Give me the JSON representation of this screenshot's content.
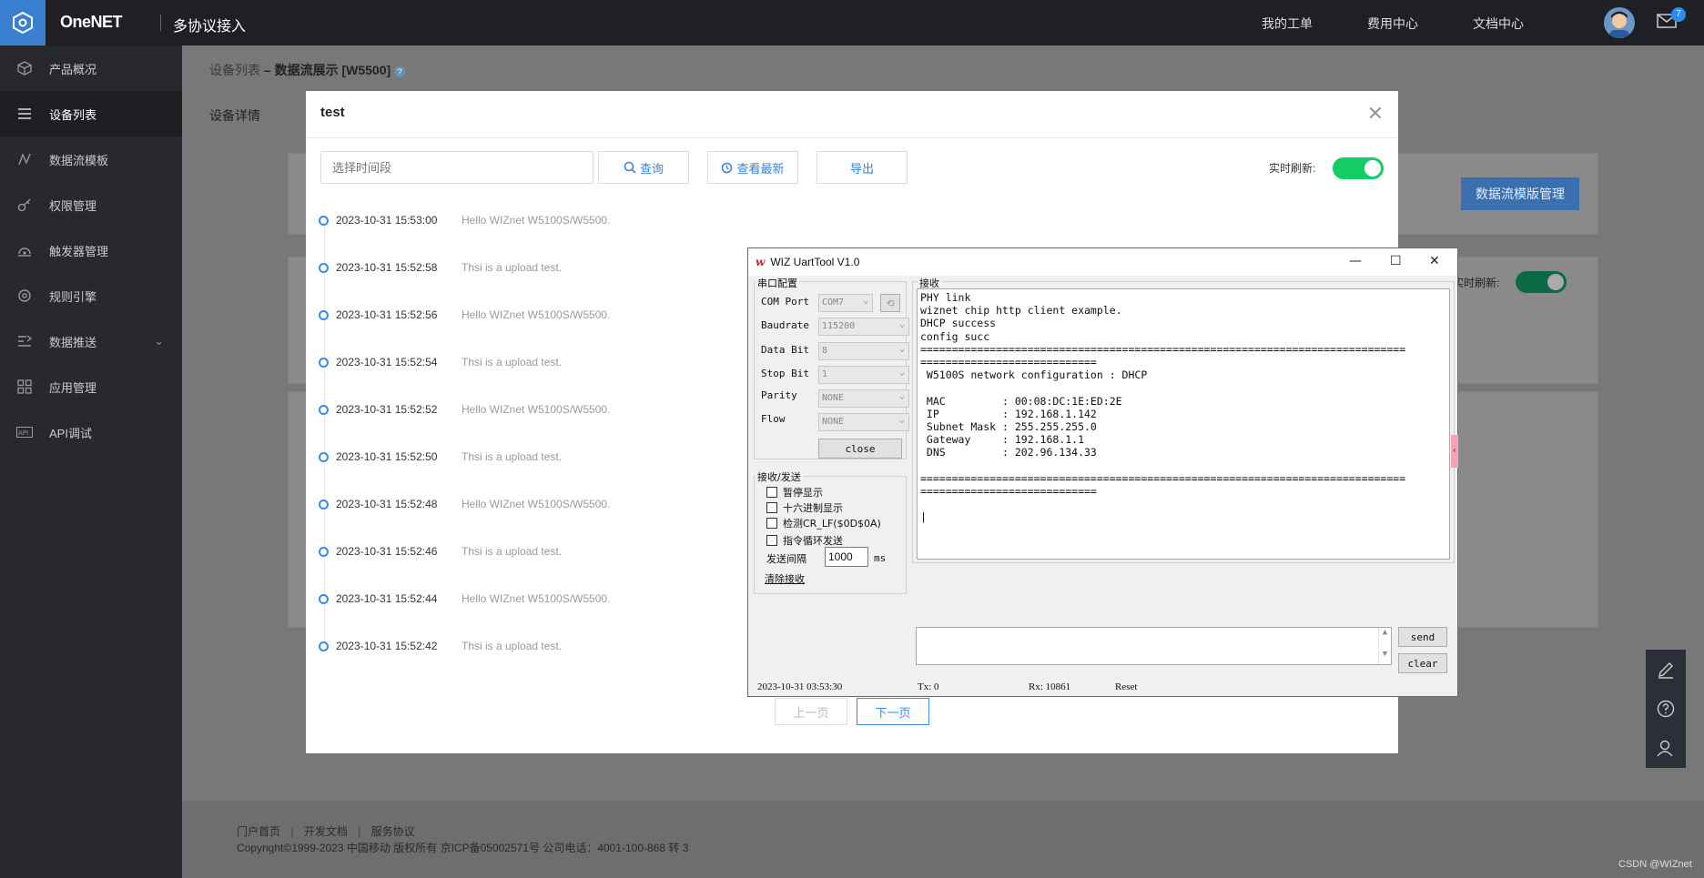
{
  "topbar": {
    "brand": "OneNET",
    "subtitle": "多协议接入",
    "nav": [
      "我的工单",
      "费用中心",
      "文档中心"
    ],
    "mail_badge": "7"
  },
  "sidebar": {
    "items": [
      {
        "label": "产品概况",
        "icon": "cube-icon"
      },
      {
        "label": "设备列表",
        "icon": "list-icon"
      },
      {
        "label": "数据流模板",
        "icon": "stream-icon"
      },
      {
        "label": "权限管理",
        "icon": "key-icon"
      },
      {
        "label": "触发器管理",
        "icon": "trigger-icon"
      },
      {
        "label": "规则引擎",
        "icon": "engine-icon"
      },
      {
        "label": "数据推送",
        "icon": "push-icon"
      },
      {
        "label": "应用管理",
        "icon": "grid-icon"
      },
      {
        "label": "API调试",
        "icon": "api-icon"
      }
    ]
  },
  "breadcrumb": {
    "parent": "设备列表",
    "current": "– 数据流展示 [W5500]"
  },
  "detail_tab": "设备详情",
  "bg": {
    "template_button": "数据流模版管理",
    "realtime_label": "实时刷新:"
  },
  "footer": {
    "links": [
      "门户首页",
      "开发文档",
      "服务协议"
    ],
    "copyright": "Copyright©1999-2023 中国移动 版权所有 京ICP备05002571号 公司电话：4001-100-868 转 3"
  },
  "watermark": "CSDN @WIZnet",
  "modal": {
    "title": "test",
    "range_placeholder": "选择时间段",
    "query_button": "查询",
    "latest_button": "查看最新",
    "export_button": "导出",
    "realtime_label": "实时刷新:",
    "timeline": [
      {
        "time": "2023-10-31 15:53:00",
        "msg": "Hello WIZnet W5100S/W5500."
      },
      {
        "time": "2023-10-31 15:52:58",
        "msg": "Thsi is a upload test."
      },
      {
        "time": "2023-10-31 15:52:56",
        "msg": "Hello WIZnet W5100S/W5500."
      },
      {
        "time": "2023-10-31 15:52:54",
        "msg": "Thsi is a upload test."
      },
      {
        "time": "2023-10-31 15:52:52",
        "msg": "Hello WIZnet W5100S/W5500."
      },
      {
        "time": "2023-10-31 15:52:50",
        "msg": "Thsi is a upload test."
      },
      {
        "time": "2023-10-31 15:52:48",
        "msg": "Hello WIZnet W5100S/W5500."
      },
      {
        "time": "2023-10-31 15:52:46",
        "msg": "Thsi is a upload test."
      },
      {
        "time": "2023-10-31 15:52:44",
        "msg": "Hello WIZnet W5100S/W5500."
      },
      {
        "time": "2023-10-31 15:52:42",
        "msg": "Thsi is a upload test."
      }
    ],
    "prev_page": "上一页",
    "next_page": "下一页"
  },
  "uart": {
    "title": "WIZ UartTool V1.0",
    "serial_group": "串口配置",
    "com_port_label": "COM Port",
    "com_port_value": "COM7",
    "baudrate_label": "Baudrate",
    "baudrate_value": "115200",
    "databit_label": "Data Bit",
    "databit_value": "8",
    "stopbit_label": "Stop Bit",
    "stopbit_value": "1",
    "parity_label": "Parity",
    "parity_value": "NONE",
    "flow_label": "Flow",
    "flow_value": "NONE",
    "close_button": "close",
    "rxtx_group": "接收/发送",
    "pause_display": "暂停显示",
    "hex_display": "十六进制显示",
    "detect_crlf": "检测CR_LF($0D$0A)",
    "loop_send": "指令循环发送",
    "interval_label": "发送间隔",
    "interval_value": "1000",
    "interval_unit": "ms",
    "clear_recv": "清除接收",
    "recv_group": "接收",
    "recv_text": "PHY link\nwiznet chip http client example.\nDHCP success\nconfig succ\n=============================================================================\n============================\n W5100S network configuration : DHCP\n\n MAC         : 00:08:DC:1E:ED:2E\n IP          : 192.168.1.142\n Subnet Mask : 255.255.255.0\n Gateway     : 192.168.1.1\n DNS         : 202.96.134.33\n\n=============================================================================\n============================\n\n|",
    "send_button": "send",
    "clear_button": "clear",
    "status_time": "2023-10-31 03:53:30",
    "status_tx": "Tx: 0",
    "status_rx": "Rx: 10861",
    "status_reset": "Reset"
  }
}
